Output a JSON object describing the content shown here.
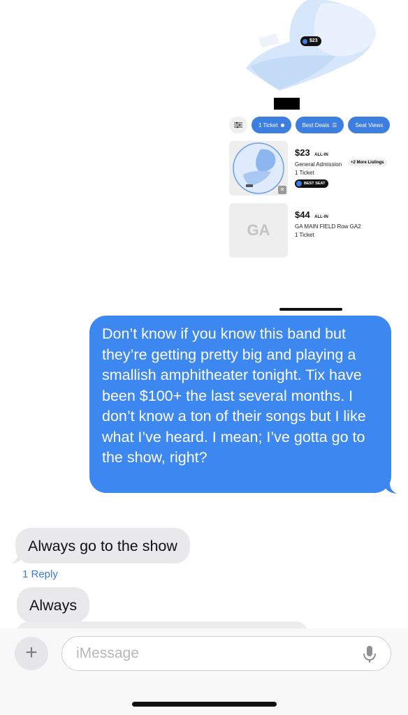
{
  "screenshot": {
    "price_pin": "$23",
    "filters": {
      "ticket_count": "1 Ticket",
      "best_deals": "Best Deals",
      "seat_views": "Seat Views"
    },
    "listings": [
      {
        "price": "$23",
        "all_in": "ALL-IN",
        "section": "General Admission",
        "more_listings": "+2 More Listings",
        "quantity": "1 Ticket",
        "badge": "BEST SEAT"
      },
      {
        "thumb_label": "GA",
        "price": "$44",
        "all_in": "ALL-IN",
        "section": "GA MAIN FIELD Row GA2",
        "quantity": "1 Ticket"
      }
    ]
  },
  "messages": {
    "outgoing": "Don’t know if you know this band but they’re getting pretty big and playing a smallish amphitheater tonight. Tix have been $100+ the last several months. I don’t know a ton of their songs but I like what I’ve heard. I mean; I’ve gotta go to the show, right?",
    "reply_1": "Always go to the show",
    "reply_link": "1 Reply",
    "reply_2": "Always"
  },
  "composer": {
    "placeholder": "iMessage"
  },
  "colors": {
    "imessage_blue": "#3d87f0",
    "incoming_gray": "#e9e9eb",
    "ticket_blue": "#3d7fe0"
  }
}
